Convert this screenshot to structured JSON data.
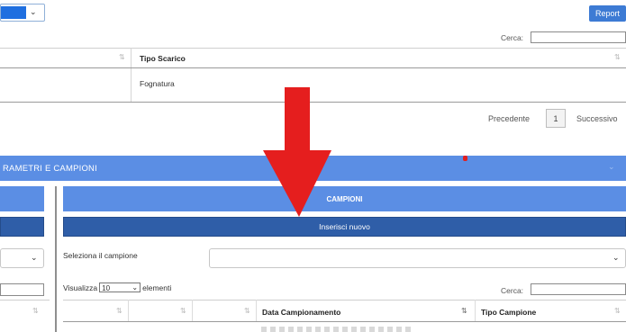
{
  "toolbar": {
    "report_label": "Report"
  },
  "top_table": {
    "search_label": "Cerca:",
    "header": "Tipo Scarico",
    "row_value": "Fognatura",
    "sort_glyph": "⇅"
  },
  "pager": {
    "prev": "Precedente",
    "page": "1",
    "next": "Successivo"
  },
  "section": {
    "title": "RAMETRI E CAMPIONI"
  },
  "campioni": {
    "title": "CAMPIONI",
    "insert_label": "Inserisci nuovo",
    "select_label": "Seleziona il campione",
    "show_prefix": "Visualizza",
    "page_size": "10",
    "show_suffix": "elementi",
    "search_label": "Cerca:",
    "columns": [
      "Data Campionamento",
      "Tipo Campione"
    ]
  },
  "annotation": {
    "color": "#e02020"
  }
}
